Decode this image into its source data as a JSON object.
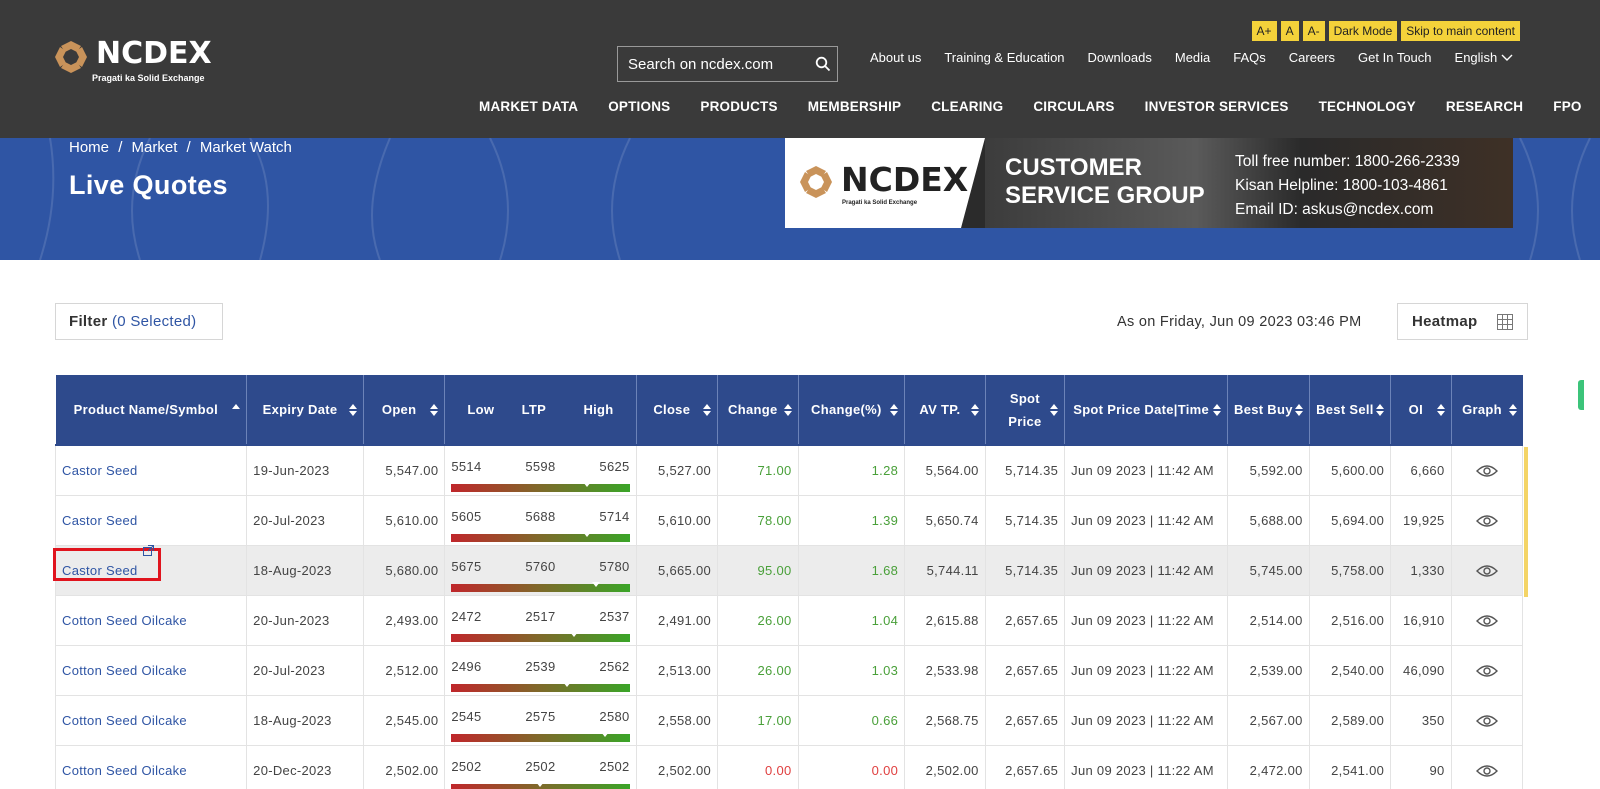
{
  "header": {
    "logo_text": "NCDEX",
    "logo_tagline": "Pragati ka Solid Exchange",
    "a11y": [
      "A+",
      "A",
      "A-",
      "Dark Mode",
      "Skip to main content"
    ],
    "search_placeholder": "Search on ncdex.com",
    "top_links": [
      "About us",
      "Training & Education",
      "Downloads",
      "Media",
      "FAQs",
      "Careers",
      "Get In Touch"
    ],
    "language": "English",
    "nav": [
      "MARKET DATA",
      "OPTIONS",
      "PRODUCTS",
      "MEMBERSHIP",
      "CLEARING",
      "CIRCULARS",
      "INVESTOR SERVICES",
      "TECHNOLOGY",
      "RESEARCH",
      "FPO"
    ]
  },
  "banner": {
    "breadcrumb": [
      "Home",
      "Market",
      "Market Watch"
    ],
    "breadcrumb_sep": "/",
    "title": "Live Quotes",
    "csg_logo_text": "NCDEX",
    "csg_logo_tagline": "Pragati ka Solid Exchange",
    "csg_title": "CUSTOMER SERVICE GROUP",
    "csg_lines": [
      "Toll free number: 1800-266-2339",
      "Kisan Helpline: 1800-103-4861",
      "Email ID: askus@ncdex.com"
    ]
  },
  "toolbar": {
    "filter_label": "Filter",
    "filter_count": "(0 Selected)",
    "as_on": "As on Friday, Jun 09 2023 03:46 PM",
    "heatmap_label": "Heatmap"
  },
  "table": {
    "columns": [
      "Product Name/Symbol",
      "Expiry Date",
      "Open",
      "Low",
      "LTP",
      "High",
      "Close",
      "Change",
      "Change(%)",
      "AV TP.",
      "Spot Price",
      "Spot Price Date|Time",
      "Best Buy",
      "Best Sell",
      "OI",
      "Graph"
    ],
    "rows": [
      {
        "product": "Castor Seed",
        "expiry": "19-Jun-2023",
        "open": "5,547.00",
        "low": "5514",
        "ltp": "5598",
        "high": "5625",
        "ltp_position": 0.76,
        "close": "5,527.00",
        "change": "71.00",
        "change_pct": "1.28",
        "avtp": "5,564.00",
        "spot": "5,714.35",
        "spot_time": "Jun 09 2023 | 11:42 AM",
        "best_buy": "5,592.00",
        "best_sell": "5,600.00",
        "oi": "6,660",
        "trend": "pos"
      },
      {
        "product": "Castor Seed",
        "expiry": "20-Jul-2023",
        "open": "5,610.00",
        "low": "5605",
        "ltp": "5688",
        "high": "5714",
        "ltp_position": 0.76,
        "close": "5,610.00",
        "change": "78.00",
        "change_pct": "1.39",
        "avtp": "5,650.74",
        "spot": "5,714.35",
        "spot_time": "Jun 09 2023 | 11:42 AM",
        "best_buy": "5,688.00",
        "best_sell": "5,694.00",
        "oi": "19,925",
        "trend": "pos"
      },
      {
        "product": "Castor Seed",
        "expiry": "18-Aug-2023",
        "open": "5,680.00",
        "low": "5675",
        "ltp": "5760",
        "high": "5780",
        "ltp_position": 0.81,
        "close": "5,665.00",
        "change": "95.00",
        "change_pct": "1.68",
        "avtp": "5,744.11",
        "spot": "5,714.35",
        "spot_time": "Jun 09 2023 | 11:42 AM",
        "best_buy": "5,745.00",
        "best_sell": "5,758.00",
        "oi": "1,330",
        "trend": "pos"
      },
      {
        "product": "Cotton Seed Oilcake",
        "expiry": "20-Jun-2023",
        "open": "2,493.00",
        "low": "2472",
        "ltp": "2517",
        "high": "2537",
        "ltp_position": 0.69,
        "close": "2,491.00",
        "change": "26.00",
        "change_pct": "1.04",
        "avtp": "2,615.88",
        "spot": "2,657.65",
        "spot_time": "Jun 09 2023 | 11:22 AM",
        "best_buy": "2,514.00",
        "best_sell": "2,516.00",
        "oi": "16,910",
        "trend": "pos"
      },
      {
        "product": "Cotton Seed Oilcake",
        "expiry": "20-Jul-2023",
        "open": "2,512.00",
        "low": "2496",
        "ltp": "2539",
        "high": "2562",
        "ltp_position": 0.65,
        "close": "2,513.00",
        "change": "26.00",
        "change_pct": "1.03",
        "avtp": "2,533.98",
        "spot": "2,657.65",
        "spot_time": "Jun 09 2023 | 11:22 AM",
        "best_buy": "2,539.00",
        "best_sell": "2,540.00",
        "oi": "46,090",
        "trend": "pos"
      },
      {
        "product": "Cotton Seed Oilcake",
        "expiry": "18-Aug-2023",
        "open": "2,545.00",
        "low": "2545",
        "ltp": "2575",
        "high": "2580",
        "ltp_position": 0.86,
        "close": "2,558.00",
        "change": "17.00",
        "change_pct": "0.66",
        "avtp": "2,568.75",
        "spot": "2,657.65",
        "spot_time": "Jun 09 2023 | 11:22 AM",
        "best_buy": "2,567.00",
        "best_sell": "2,589.00",
        "oi": "350",
        "trend": "pos"
      },
      {
        "product": "Cotton Seed Oilcake",
        "expiry": "20-Dec-2023",
        "open": "2,502.00",
        "low": "2502",
        "ltp": "2502",
        "high": "2502",
        "ltp_position": 0.5,
        "close": "2,502.00",
        "change": "0.00",
        "change_pct": "0.00",
        "avtp": "2,502.00",
        "spot": "2,657.65",
        "spot_time": "Jun 09 2023 | 11:22 AM",
        "best_buy": "2,472.00",
        "best_sell": "2,541.00",
        "oi": "90",
        "trend": "neg"
      }
    ]
  },
  "colors": {
    "header_bg": "#3a3a3a",
    "banner_bg": "#2f55a4",
    "table_header_bg": "#2e4a8c",
    "link": "#2f55a4",
    "positive": "#4aa03a",
    "negative": "#e04040",
    "a11y_button": "#f4d23a",
    "highlight": "#e0141e"
  },
  "icons": [
    "search-icon",
    "chevron-down-icon",
    "grid-icon",
    "eye-icon",
    "external-link-icon",
    "logo-mark-icon"
  ]
}
